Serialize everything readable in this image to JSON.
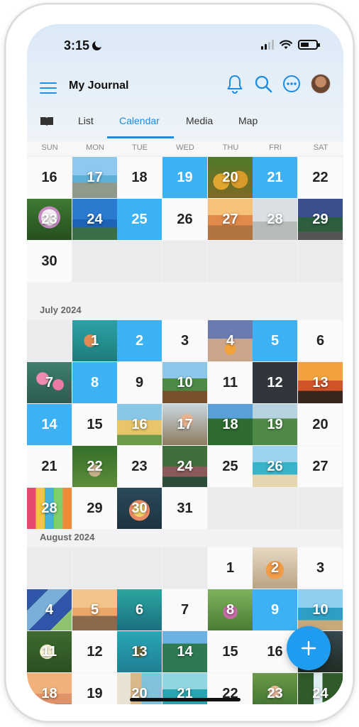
{
  "status": {
    "time": "3:15"
  },
  "app": {
    "title": "My Journal"
  },
  "tabs": {
    "list": "List",
    "calendar": "Calendar",
    "media": "Media",
    "map": "Map"
  },
  "weekdays": [
    "SUN",
    "MON",
    "TUE",
    "WED",
    "THU",
    "FRI",
    "SAT"
  ],
  "icons": {
    "menu": "hamburger-menu",
    "book": "book-icon",
    "bell": "bell-icon",
    "search": "search-icon",
    "more": "ellipsis-circle-icon",
    "add": "plus-icon"
  },
  "colors": {
    "accent": "#1f8be0",
    "entry_blue": "#3cb2f5",
    "selected_dark": "#31363c"
  },
  "months": [
    "July 2024",
    "August 2024"
  ],
  "june_tail": [
    {
      "day": "16",
      "t": "plain"
    },
    {
      "day": "17",
      "t": "photo",
      "p": "beach-road"
    },
    {
      "day": "18",
      "t": "plain"
    },
    {
      "day": "19",
      "t": "blue"
    },
    {
      "day": "20",
      "t": "photo",
      "p": "pineapples"
    },
    {
      "day": "21",
      "t": "blue"
    },
    {
      "day": "22",
      "t": "plain"
    },
    {
      "day": "23",
      "t": "photo",
      "p": "orchid"
    },
    {
      "day": "24",
      "t": "photo",
      "p": "ocean-city"
    },
    {
      "day": "25",
      "t": "blue"
    },
    {
      "day": "26",
      "t": "plain"
    },
    {
      "day": "27",
      "t": "photo",
      "p": "couple-sunset"
    },
    {
      "day": "28",
      "t": "photo",
      "p": "bicycle"
    },
    {
      "day": "29",
      "t": "photo",
      "p": "dusk-road"
    },
    {
      "day": "30",
      "t": "plain"
    }
  ],
  "july": [
    {
      "day": "1",
      "t": "photo",
      "p": "reef"
    },
    {
      "day": "2",
      "t": "blue"
    },
    {
      "day": "3",
      "t": "plain"
    },
    {
      "day": "4",
      "t": "photo",
      "p": "campfire"
    },
    {
      "day": "5",
      "t": "blue"
    },
    {
      "day": "6",
      "t": "plain"
    },
    {
      "day": "7",
      "t": "photo",
      "p": "flamingos"
    },
    {
      "day": "8",
      "t": "blue"
    },
    {
      "day": "9",
      "t": "plain"
    },
    {
      "day": "10",
      "t": "photo",
      "p": "park-sign"
    },
    {
      "day": "11",
      "t": "plain"
    },
    {
      "day": "12",
      "t": "dark"
    },
    {
      "day": "13",
      "t": "photo",
      "p": "palm-sunset"
    },
    {
      "day": "14",
      "t": "blue"
    },
    {
      "day": "15",
      "t": "plain"
    },
    {
      "day": "16",
      "t": "photo",
      "p": "food-truck"
    },
    {
      "day": "17",
      "t": "photo",
      "p": "ukulele"
    },
    {
      "day": "18",
      "t": "photo",
      "p": "palms"
    },
    {
      "day": "19",
      "t": "photo",
      "p": "green-mountains"
    },
    {
      "day": "20",
      "t": "plain"
    },
    {
      "day": "21",
      "t": "plain"
    },
    {
      "day": "22",
      "t": "photo",
      "p": "flower-arch"
    },
    {
      "day": "23",
      "t": "plain"
    },
    {
      "day": "24",
      "t": "photo",
      "p": "lush-pond"
    },
    {
      "day": "25",
      "t": "plain"
    },
    {
      "day": "26",
      "t": "photo",
      "p": "resort-beach"
    },
    {
      "day": "27",
      "t": "plain"
    },
    {
      "day": "28",
      "t": "photo",
      "p": "surfboards"
    },
    {
      "day": "29",
      "t": "plain"
    },
    {
      "day": "30",
      "t": "photo",
      "p": "plumeria-hands"
    },
    {
      "day": "31",
      "t": "plain"
    }
  ],
  "august": [
    {
      "day": "1",
      "t": "plain"
    },
    {
      "day": "2",
      "t": "photo",
      "p": "papaya"
    },
    {
      "day": "3",
      "t": "plain"
    },
    {
      "day": "4",
      "t": "photo",
      "p": "fabric"
    },
    {
      "day": "5",
      "t": "photo",
      "p": "sunset-shore"
    },
    {
      "day": "6",
      "t": "photo",
      "p": "fish"
    },
    {
      "day": "7",
      "t": "plain"
    },
    {
      "day": "8",
      "t": "photo",
      "p": "smoothie-bowl"
    },
    {
      "day": "9",
      "t": "blue"
    },
    {
      "day": "10",
      "t": "photo",
      "p": "canoe"
    },
    {
      "day": "11",
      "t": "photo",
      "p": "plumeria"
    },
    {
      "day": "12",
      "t": "plain"
    },
    {
      "day": "13",
      "t": "photo",
      "p": "turtle"
    },
    {
      "day": "14",
      "t": "photo",
      "p": "palm-canopy"
    },
    {
      "day": "15",
      "t": "plain"
    },
    {
      "day": "16",
      "t": "plain"
    },
    {
      "day": "17",
      "t": "photo",
      "p": "dark-trees"
    },
    {
      "day": "18",
      "t": "photo",
      "p": "surfer-sunset"
    },
    {
      "day": "19",
      "t": "plain"
    },
    {
      "day": "20",
      "t": "photo",
      "p": "boards-row"
    },
    {
      "day": "21",
      "t": "photo",
      "p": "lagoon"
    },
    {
      "day": "22",
      "t": "plain"
    },
    {
      "day": "23",
      "t": "photo",
      "p": "woman-garden"
    },
    {
      "day": "24",
      "t": "photo",
      "p": "waterfall"
    }
  ]
}
